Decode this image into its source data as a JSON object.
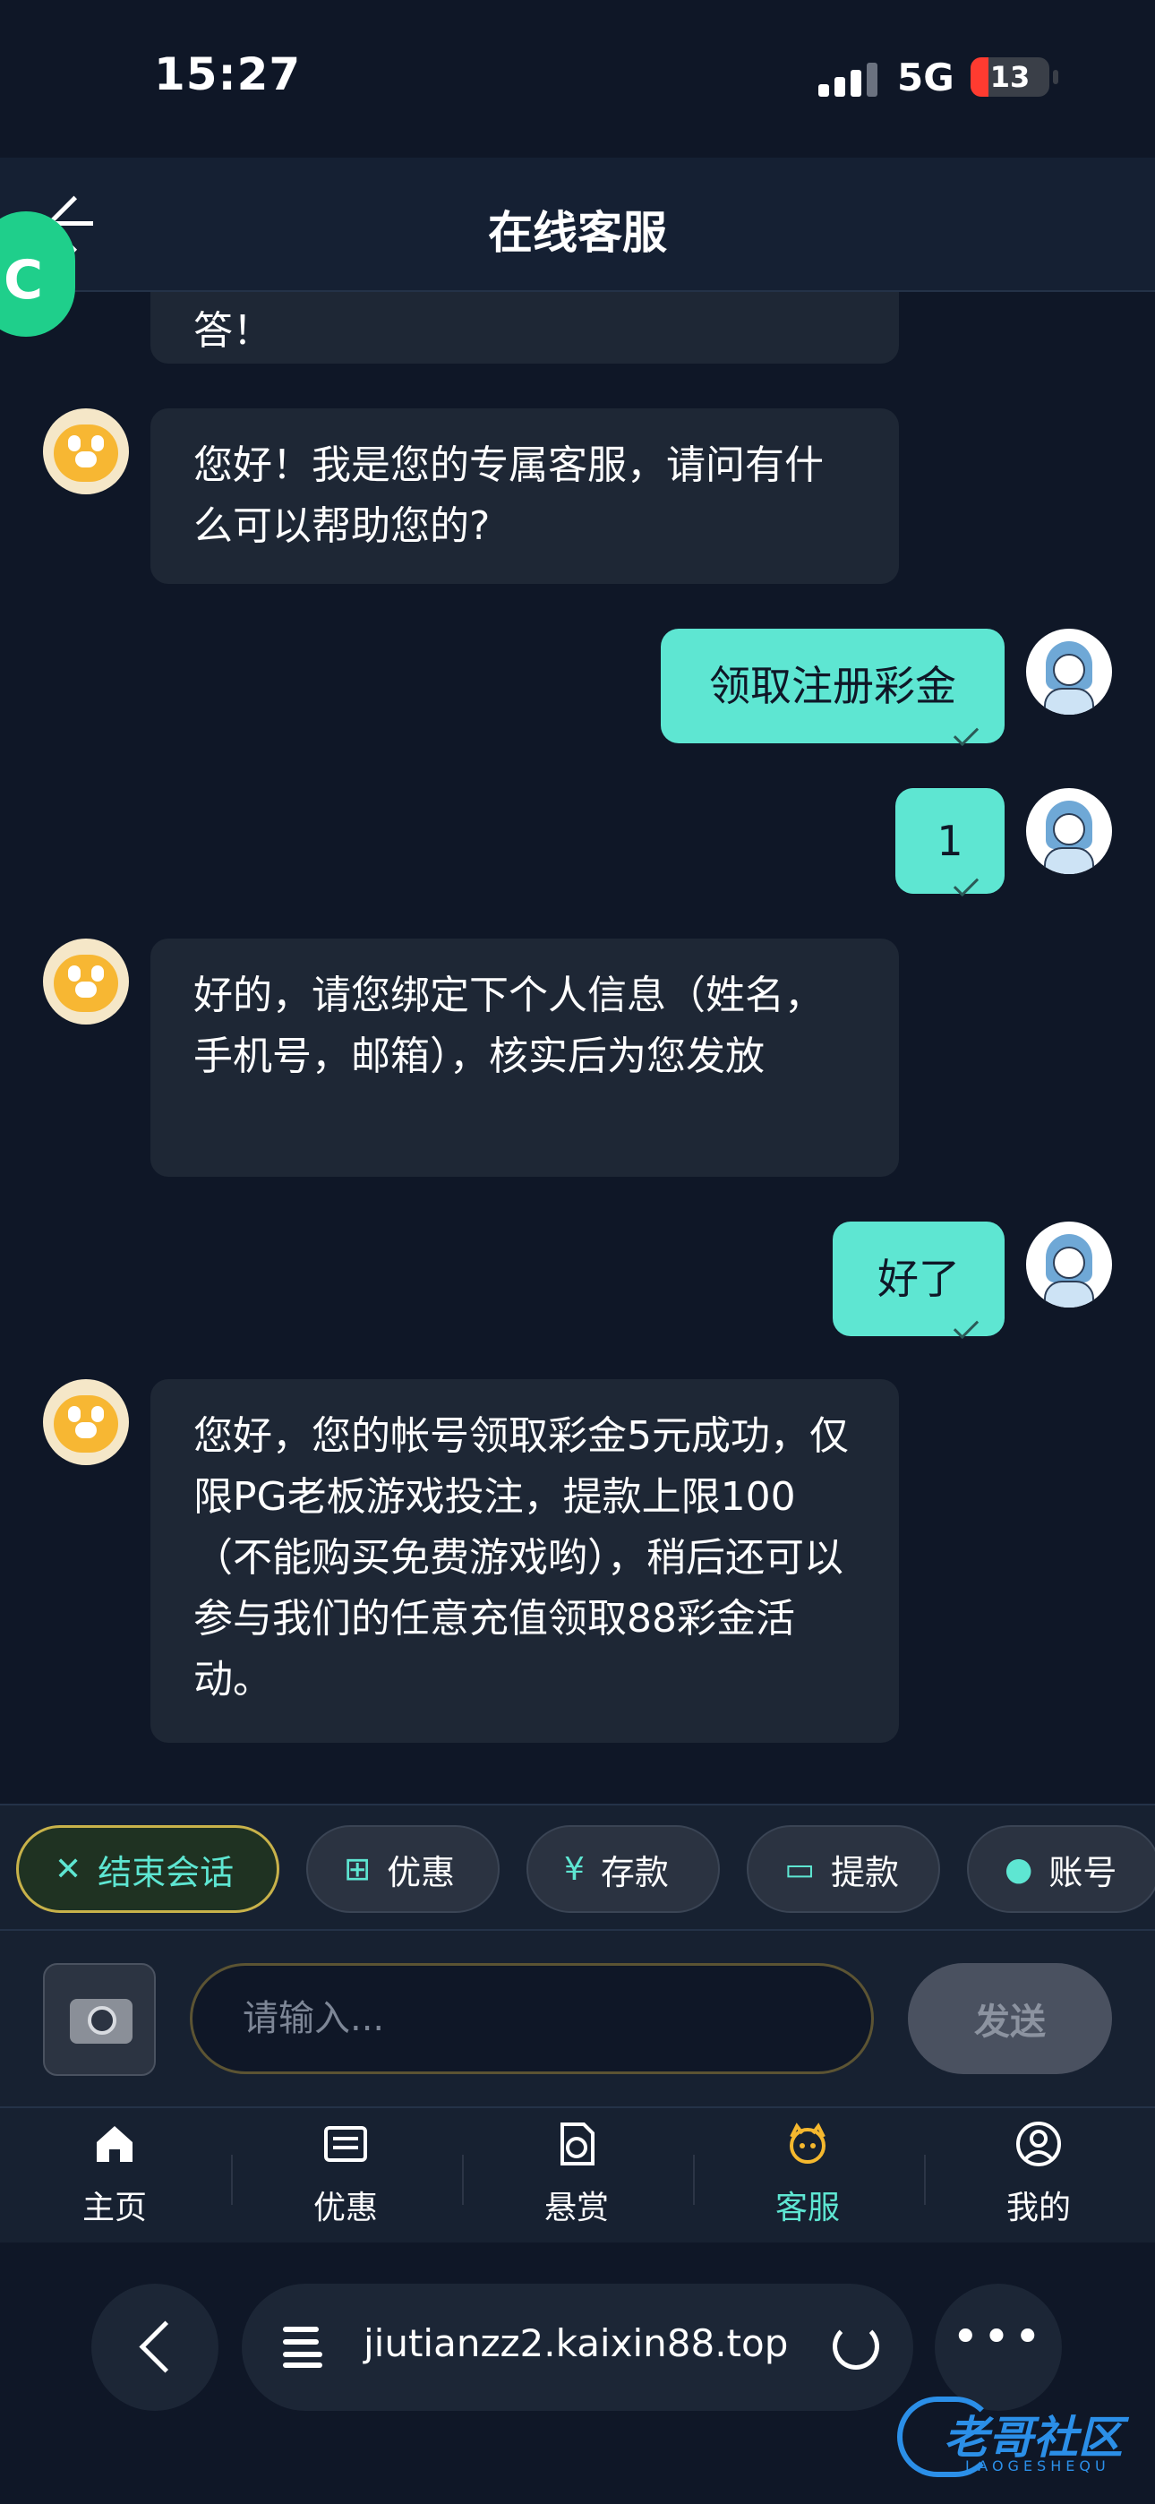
{
  "status_bar": {
    "time": "15:27",
    "network": "5G",
    "battery": "13",
    "battery_color": "#ff3b30"
  },
  "header": {
    "title": "在线客服",
    "back_icon": "arrow-left-icon"
  },
  "floating_badge": {
    "text": "C"
  },
  "messages": [
    {
      "from": "bot",
      "text": "答！"
    },
    {
      "from": "bot",
      "text": "您好！我是您的专属客服，请问有什么可以帮助您的?"
    },
    {
      "from": "user",
      "text": "领取注册彩金"
    },
    {
      "from": "user",
      "text": "1"
    },
    {
      "from": "bot",
      "text": "好的，请您绑定下个人信息（姓名，手机号，邮箱），核实后为您发放"
    },
    {
      "from": "user",
      "text": "好了"
    },
    {
      "from": "bot",
      "text": "您好，您的帐号领取彩金5元成功，仅限PG老板游戏投注，提款上限100（不能购买免费游戏哟），稍后还可以参与我们的任意充值领取88彩金活动。"
    }
  ],
  "quick_actions": [
    {
      "label": "结束会话",
      "icon": "close-icon"
    },
    {
      "label": "优惠",
      "icon": "gift-icon"
    },
    {
      "label": "存款",
      "icon": "yen-icon"
    },
    {
      "label": "提款",
      "icon": "card-icon"
    },
    {
      "label": "账号",
      "icon": "user-icon"
    }
  ],
  "input": {
    "placeholder": "请输入...",
    "value": "",
    "send_label": "发送"
  },
  "tabs": [
    {
      "label": "主页",
      "icon": "home-icon"
    },
    {
      "label": "优惠",
      "icon": "list-icon"
    },
    {
      "label": "悬赏",
      "icon": "reward-icon"
    },
    {
      "label": "客服",
      "icon": "support-icon",
      "active": true
    },
    {
      "label": "我的",
      "icon": "profile-icon"
    }
  ],
  "browser": {
    "url": "jiutianzz2.kaixin88.top"
  },
  "watermark": {
    "text": "老哥社区",
    "sub": "LAOGESHEQU"
  },
  "colors": {
    "accent": "#5ee6d2",
    "background": "#0f1727",
    "bubble_in": "#1e2735"
  }
}
